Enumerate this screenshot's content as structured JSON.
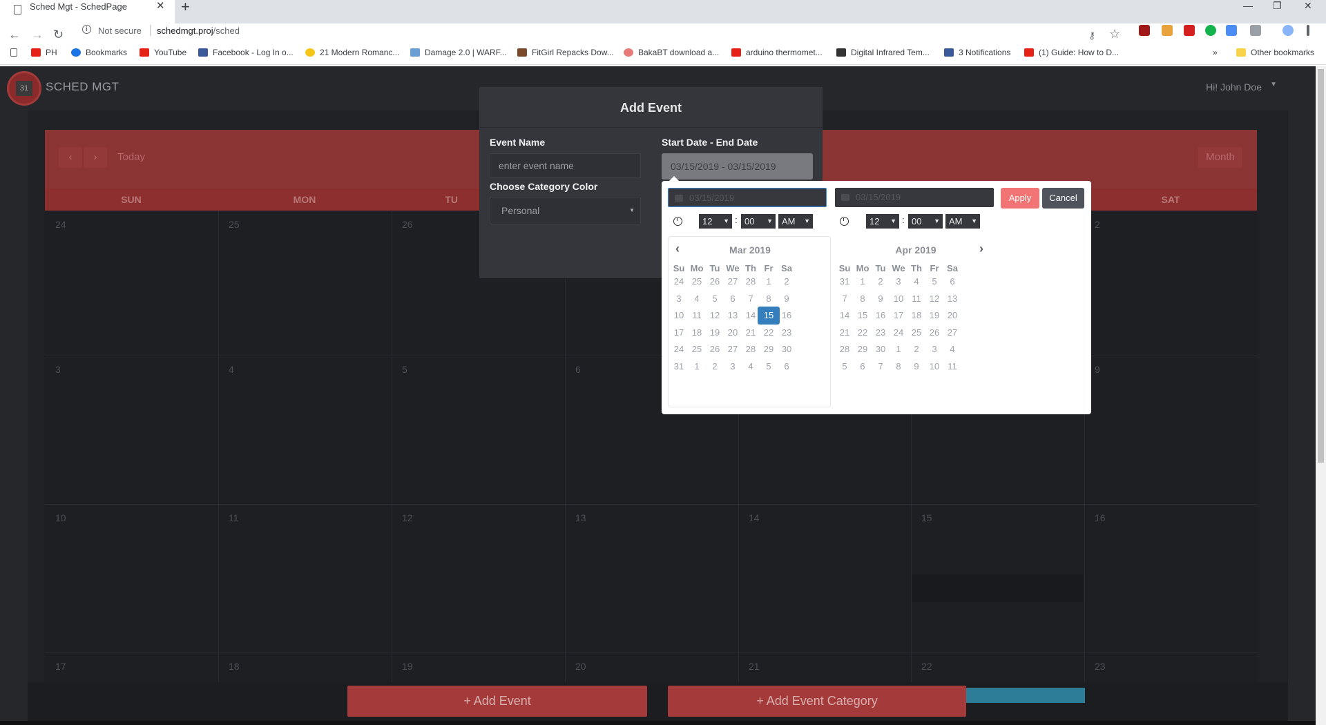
{
  "browser": {
    "tab_title": "Sched Mgt - SchedPage",
    "tab_close": "✕",
    "new_tab": "+",
    "not_secure": "Not secure",
    "url_host": "schedmgt.proj",
    "url_path": "/sched",
    "bookmarks": [
      "PH",
      "Bookmarks",
      "YouTube",
      "Facebook - Log In o...",
      "21 Modern Romanc...",
      "Damage 2.0 | WARF...",
      "FitGirl Repacks Dow...",
      "BakaBT download a...",
      "arduino thermomet...",
      "Digital Infrared Tem...",
      "3 Notifications",
      "(1) Guide: How to D..."
    ],
    "more_bookmarks": "»",
    "other_bookmarks": "Other bookmarks"
  },
  "app": {
    "brand": "SCHED MGT",
    "logo_text": "31",
    "user_greeting": "Hi! John Doe"
  },
  "calendar": {
    "today_label": "Today",
    "month_label": "Month",
    "weekdays": [
      "SUN",
      "MON",
      "TU",
      "",
      "",
      "",
      "SAT"
    ],
    "rows": [
      [
        "24",
        "25",
        "26",
        "",
        "",
        "",
        "2"
      ],
      [
        "3",
        "4",
        "5",
        "6",
        "",
        "",
        "9"
      ],
      [
        "10",
        "11",
        "12",
        "13",
        "14",
        "15",
        "16"
      ],
      [
        "17",
        "18",
        "19",
        "20",
        "21",
        "22",
        "23"
      ]
    ]
  },
  "modal": {
    "title": "Add Event",
    "event_name_label": "Event Name",
    "event_name_placeholder": "enter event name",
    "date_label": "Start Date - End Date",
    "date_value": "03/15/2019 - 03/15/2019",
    "category_label": "Choose Category Color",
    "category_value": "Personal"
  },
  "daterangepicker": {
    "start_input": "03/15/2019",
    "end_input": "03/15/2019",
    "apply_label": "Apply",
    "cancel_label": "Cancel",
    "start_time": {
      "hour": "12",
      "minute": "00",
      "ampm": "AM"
    },
    "end_time": {
      "hour": "12",
      "minute": "00",
      "ampm": "AM"
    },
    "weekday_headers": [
      "Su",
      "Mo",
      "Tu",
      "We",
      "Th",
      "Fr",
      "Sa"
    ],
    "left_month": "Mar 2019",
    "right_month": "Apr 2019",
    "left_days": [
      [
        "24",
        "25",
        "26",
        "27",
        "28",
        "1",
        "2"
      ],
      [
        "3",
        "4",
        "5",
        "6",
        "7",
        "8",
        "9"
      ],
      [
        "10",
        "11",
        "12",
        "13",
        "14",
        "15",
        "16"
      ],
      [
        "17",
        "18",
        "19",
        "20",
        "21",
        "22",
        "23"
      ],
      [
        "24",
        "25",
        "26",
        "27",
        "28",
        "29",
        "30"
      ],
      [
        "31",
        "1",
        "2",
        "3",
        "4",
        "5",
        "6"
      ]
    ],
    "right_days": [
      [
        "31",
        "1",
        "2",
        "3",
        "4",
        "5",
        "6"
      ],
      [
        "7",
        "8",
        "9",
        "10",
        "11",
        "12",
        "13"
      ],
      [
        "14",
        "15",
        "16",
        "17",
        "18",
        "19",
        "20"
      ],
      [
        "21",
        "22",
        "23",
        "24",
        "25",
        "26",
        "27"
      ],
      [
        "28",
        "29",
        "30",
        "1",
        "2",
        "3",
        "4"
      ],
      [
        "5",
        "6",
        "7",
        "8",
        "9",
        "10",
        "11"
      ]
    ],
    "selected_day": "15"
  },
  "actions": {
    "add_event": "+ Add Event",
    "add_event_category": "+ Add Event Category"
  },
  "colors": {
    "accent_red": "#a43a3a",
    "selected_blue": "#357ebd",
    "apply_red": "#f27474",
    "cancel_gray": "#4f535c"
  }
}
